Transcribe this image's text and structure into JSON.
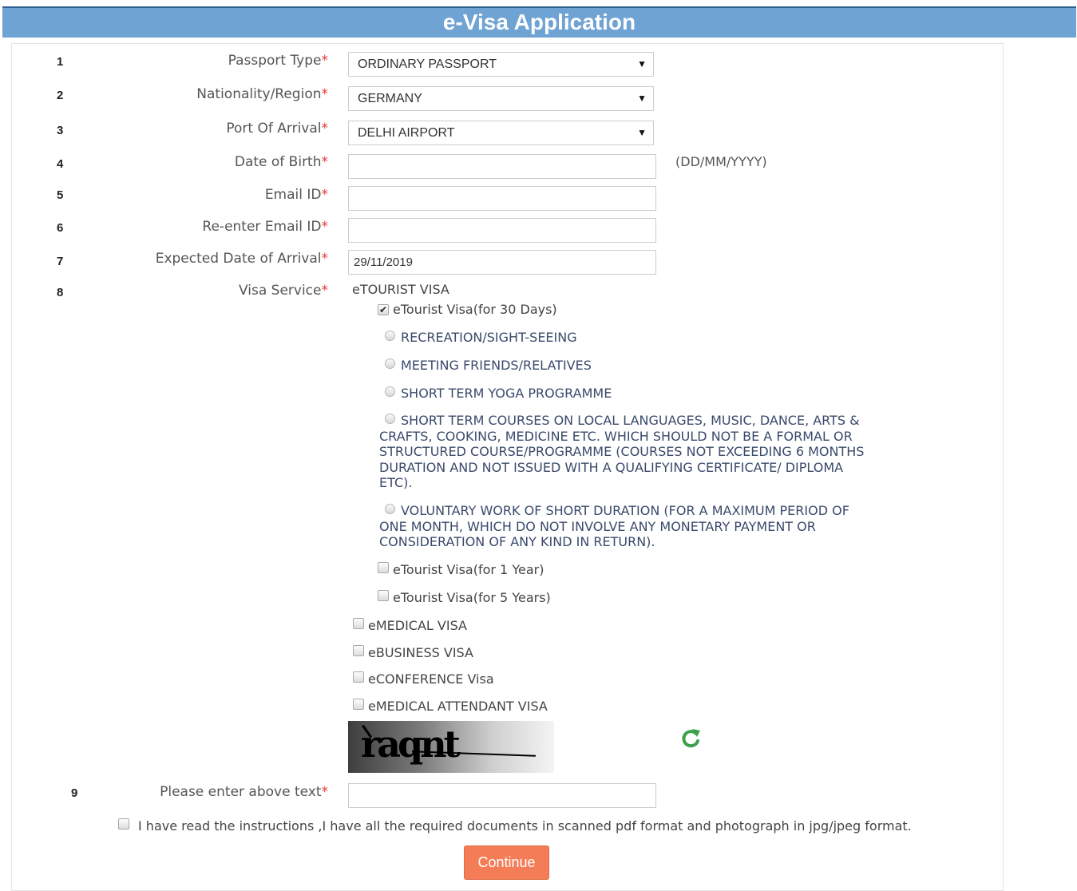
{
  "header": {
    "title": "e-Visa Application"
  },
  "form": {
    "required_mark": "*",
    "fields": [
      {
        "num": "1",
        "label": "Passport Type",
        "value": "ORDINARY PASSPORT"
      },
      {
        "num": "2",
        "label": "Nationality/Region",
        "value": "GERMANY"
      },
      {
        "num": "3",
        "label": "Port Of Arrival",
        "value": "DELHI AIRPORT"
      },
      {
        "num": "4",
        "label": "Date of Birth",
        "value": "",
        "hint": "(DD/MM/YYYY)"
      },
      {
        "num": "5",
        "label": "Email ID",
        "value": ""
      },
      {
        "num": "6",
        "label": "Re-enter Email ID",
        "value": ""
      },
      {
        "num": "7",
        "label": "Expected Date of Arrival",
        "value": "29/11/2019"
      },
      {
        "num": "8",
        "label": "Visa Service"
      },
      {
        "num": "9",
        "label": "Please enter above text",
        "value": ""
      }
    ],
    "dropdown_arrow": "▼"
  },
  "visa_service": {
    "group_title": "eTOURIST VISA",
    "etourist_30": {
      "label": "eTourist Visa(for 30 Days)",
      "checked": true
    },
    "purposes": [
      "RECREATION/SIGHT-SEEING",
      "MEETING FRIENDS/RELATIVES",
      "SHORT TERM YOGA PROGRAMME",
      "SHORT TERM COURSES ON LOCAL LANGUAGES, MUSIC, DANCE, ARTS & CRAFTS, COOKING, MEDICINE ETC. WHICH SHOULD NOT BE A FORMAL OR STRUCTURED COURSE/PROGRAMME (COURSES NOT EXCEEDING 6 MONTHS DURATION AND NOT ISSUED WITH A QUALIFYING CERTIFICATE/ DIPLOMA ETC).",
      "VOLUNTARY WORK OF SHORT DURATION (FOR A MAXIMUM PERIOD OF ONE MONTH, WHICH DO NOT INVOLVE ANY MONETARY PAYMENT OR CONSIDERATION OF ANY KIND IN RETURN)."
    ],
    "etourist_1y": "eTourist Visa(for 1 Year)",
    "etourist_5y": "eTourist Visa(for 5 Years)",
    "other_visas": [
      "eMEDICAL VISA",
      "eBUSINESS VISA",
      "eCONFERENCE Visa",
      "eMEDICAL ATTENDANT VISA"
    ]
  },
  "captcha": {
    "text": "raqnt",
    "refresh_icon": "refresh-icon"
  },
  "agreement": {
    "label": "I have read the instructions ,I have all the required documents in scanned pdf format and photograph in jpg/jpeg format.",
    "checked": false
  },
  "continue_button": {
    "label": "Continue"
  },
  "colors": {
    "header": "#6fa3d3",
    "button": "#f47c57",
    "required": "#e53935",
    "refresh": "#3aa04a"
  }
}
